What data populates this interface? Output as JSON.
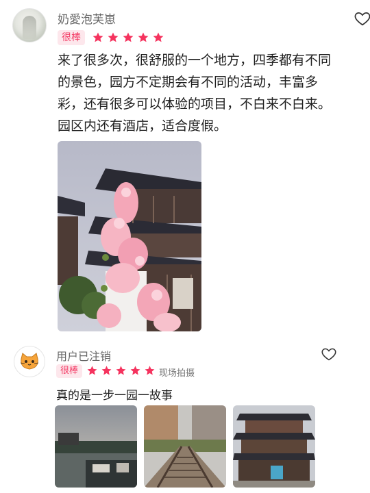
{
  "reviews": [
    {
      "username": "奶愛泡芙崽",
      "rating_label": "很棒",
      "stars": 5,
      "text": "来了很多次，很舒服的一个地方，四季都有不同的景色，园方不定期会有不同的活动，丰富多彩，还有很多可以体验的项目，不白来不白来。园区内还有酒店，适合度假。",
      "text_lines": [
        "来了很多次，很舒服的一个地方，四季都有不同",
        "的景色，园方不定期会有不同的活动，丰富多",
        "彩，还有很多可以体验的项目，不白来不白来。",
        "园区内还有酒店，适合度假。"
      ],
      "photos": [
        "pagoda-with-pink-flowers"
      ]
    },
    {
      "username": "用户已注销",
      "rating_label": "很棒",
      "stars": 5,
      "tag": "现场拍摄",
      "text": "真的是一步一园一故事",
      "photos": [
        "lake-view",
        "railway-track-autumn",
        "pagoda-tower"
      ]
    }
  ],
  "icons": {
    "like": "heart-outline-icon",
    "star": "star-filled-icon"
  },
  "colors": {
    "accent": "#f5335e",
    "badge_bg": "#fde7ec",
    "username": "#666666"
  }
}
